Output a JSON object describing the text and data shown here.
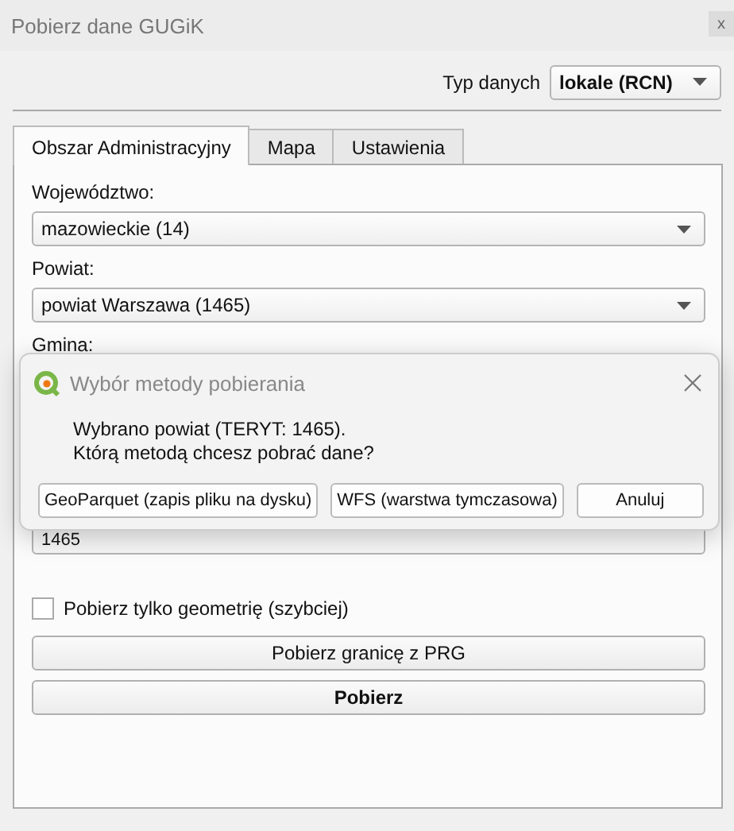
{
  "window": {
    "title": "Pobierz dane GUGiK",
    "close": "x"
  },
  "data_type": {
    "label": "Typ danych",
    "value": "lokale (RCN)"
  },
  "tabs": [
    {
      "label": "Obszar Administracyjny",
      "selected": true
    },
    {
      "label": "Mapa",
      "selected": false
    },
    {
      "label": "Ustawienia",
      "selected": false
    }
  ],
  "fields": [
    {
      "label": "Województwo:",
      "value": "mazowieckie (14)"
    },
    {
      "label": "Powiat:",
      "value": "powiat Warszawa (1465)"
    }
  ],
  "gmina_label": "Gmina:",
  "teryt_field": {
    "value": "1465"
  },
  "geometry_only": {
    "label": "Pobierz tylko geometrię (szybciej)",
    "checked": false
  },
  "buttons": [
    {
      "label": "Pobierz granicę z PRG",
      "primary": false
    },
    {
      "label": "Pobierz",
      "primary": true
    }
  ],
  "dialog": {
    "title": "Wybór metody pobierania",
    "lines": [
      "Wybrano powiat (TERYT: 1465).",
      "Którą metodą chcesz pobrać dane?"
    ],
    "buttons": [
      "GeoParquet (zapis pliku na dysku)",
      "WFS (warstwa tymczasowa)",
      "Anuluj"
    ]
  }
}
